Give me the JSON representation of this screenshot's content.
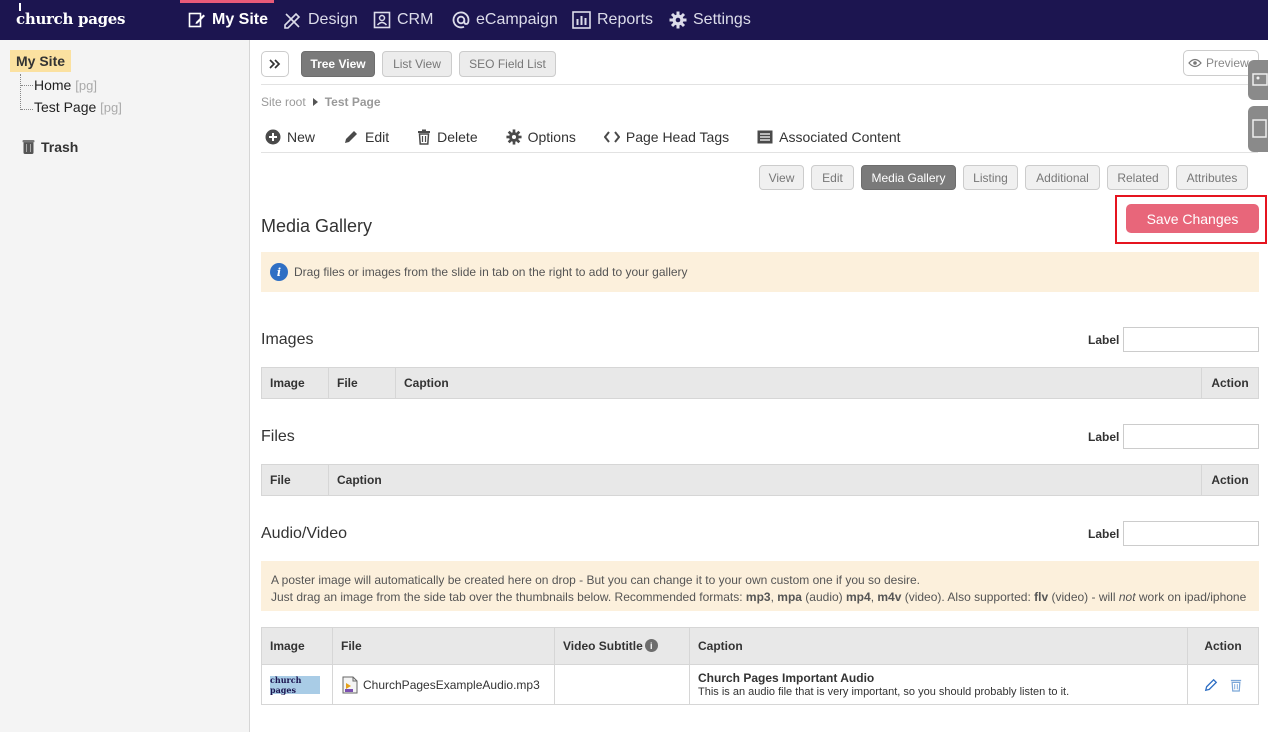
{
  "app": {
    "logo": "church pages"
  },
  "nav": [
    {
      "label": "My Site",
      "icon": "edit-page-icon"
    },
    {
      "label": "Design",
      "icon": "pencil-ruler-icon"
    },
    {
      "label": "CRM",
      "icon": "contact-card-icon"
    },
    {
      "label": "eCampaign",
      "icon": "at-sign-icon"
    },
    {
      "label": "Reports",
      "icon": "bar-chart-icon"
    },
    {
      "label": "Settings",
      "icon": "gear-icon"
    }
  ],
  "sidebar": {
    "root": "My Site",
    "items": [
      {
        "label": "Home",
        "type": "[pg]"
      },
      {
        "label": "Test Page",
        "type": "[pg]"
      }
    ],
    "trash": "Trash"
  },
  "views": {
    "tree": "Tree View",
    "list": "List View",
    "seo": "SEO Field List",
    "preview": "Preview"
  },
  "breadcrumb": {
    "root": "Site root",
    "current": "Test Page"
  },
  "toolbar": {
    "new": "New",
    "edit": "Edit",
    "delete": "Delete",
    "options": "Options",
    "head_tags": "Page Head Tags",
    "associated": "Associated Content"
  },
  "tabs": [
    "View",
    "Edit",
    "Media Gallery",
    "Listing",
    "Additional",
    "Related",
    "Attributes"
  ],
  "page_title": "Media Gallery",
  "save_button": "Save Changes",
  "info_drag": "Drag files or images from the slide in tab on the right to add to your gallery",
  "label_text": "Label",
  "images": {
    "title": "Images",
    "columns": [
      "Image",
      "File",
      "Caption",
      "Action"
    ]
  },
  "files": {
    "title": "Files",
    "columns": [
      "File",
      "Caption",
      "Action"
    ]
  },
  "audio": {
    "title": "Audio/Video",
    "notice_line1": "A poster image will automatically be created here on drop - But you can change it to your own custom one if you so desire.",
    "notice_line2_parts": {
      "a": "Just drag an image from the side tab over the thumbnails below. Recommended formats: ",
      "mp3": "mp3",
      "b": ", ",
      "mpa": "mpa",
      "c": " (audio) ",
      "mp4": "mp4",
      "d": ", ",
      "m4v": "m4v",
      "e": " (video). Also supported: ",
      "flv": "flv",
      "f": " (video) - will ",
      "not": "not",
      "g": " work on ipad/iphone"
    },
    "columns": [
      "Image",
      "File",
      "Video Subtitle",
      "Caption",
      "Action"
    ],
    "rows": [
      {
        "thumb": "church pages",
        "file": "ChurchPagesExampleAudio.mp3",
        "subtitle": "",
        "caption_title": "Church Pages Important Audio",
        "caption_text": "This is an audio file that is very important, so you should probably listen to it."
      }
    ]
  },
  "colors": {
    "topbar": "#1c1550",
    "accent": "#e85a78",
    "save": "#e8667a",
    "highlight": "#fbe1a0",
    "info": "#fcf0dc"
  }
}
